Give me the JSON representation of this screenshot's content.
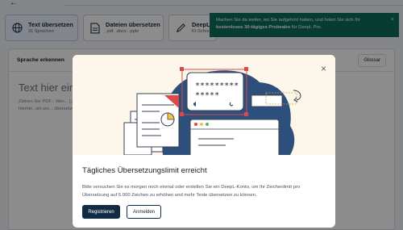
{
  "tabs": [
    {
      "title": "Text übersetzen",
      "subtitle": "31 Sprachen",
      "icon": "globe-icon"
    },
    {
      "title": "Dateien übersetzen",
      "subtitle": ".pdf, .docx, .pptx",
      "icon": "document-icon"
    },
    {
      "title": "DeepL W",
      "subtitle": "KI-Schre",
      "icon": "pen-icon"
    }
  ],
  "toast": {
    "text_before": "Machen Sie da weiter, wo Sie aufgehört haben, und holen Sie sich Ihr ",
    "bold": "kostenloses 30-tägiges Probeabo",
    "text_after": " für DeepL Pro.",
    "close": "×"
  },
  "editor": {
    "language": "Sprache erkennen",
    "glossary": "Glossar",
    "placeholder": "Text hier eing",
    "hint": "Ziehen Sie PDF-, Wor... (.pptx) hierhin, um sie... übersetzen."
  },
  "modal": {
    "title": "Tägliches Übersetzungslimit erreicht",
    "body": "Bitte versuchen Sie es morgen noch einmal oder erstellen Sie ein DeepL-Konto, um Ihr Zeichenlimit pro Übersetzung auf 5.000 Zeichen zu erhöhen und mehr Texte übersetzen zu können.",
    "primary_button": "Registrieren",
    "secondary_button": "Anmelden",
    "close": "×",
    "password_stars_1": "*********",
    "password_stars_2": "*****"
  },
  "colors": {
    "toast_bg": "#0b6e5a",
    "primary": "#0f2b46",
    "illustration_bg": "#fdf6ea",
    "blob": "#2d4f7c",
    "accent_red": "#d94a4a"
  }
}
